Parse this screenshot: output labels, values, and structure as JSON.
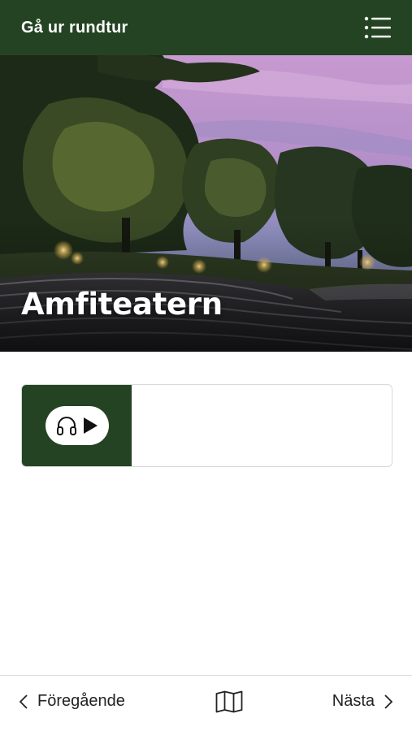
{
  "header": {
    "title": "Gå ur rundtur",
    "menu_icon": "menu-list-icon"
  },
  "hero": {
    "title": "Amfiteatern"
  },
  "audio": {
    "icon": "headphones-icon",
    "play_icon": "play-icon"
  },
  "bottom_nav": {
    "prev_label": "Föregående",
    "next_label": "Nästa",
    "map_icon": "map-icon"
  },
  "colors": {
    "brand_green": "#244322",
    "background": "#ffffff",
    "text": "#222222"
  }
}
